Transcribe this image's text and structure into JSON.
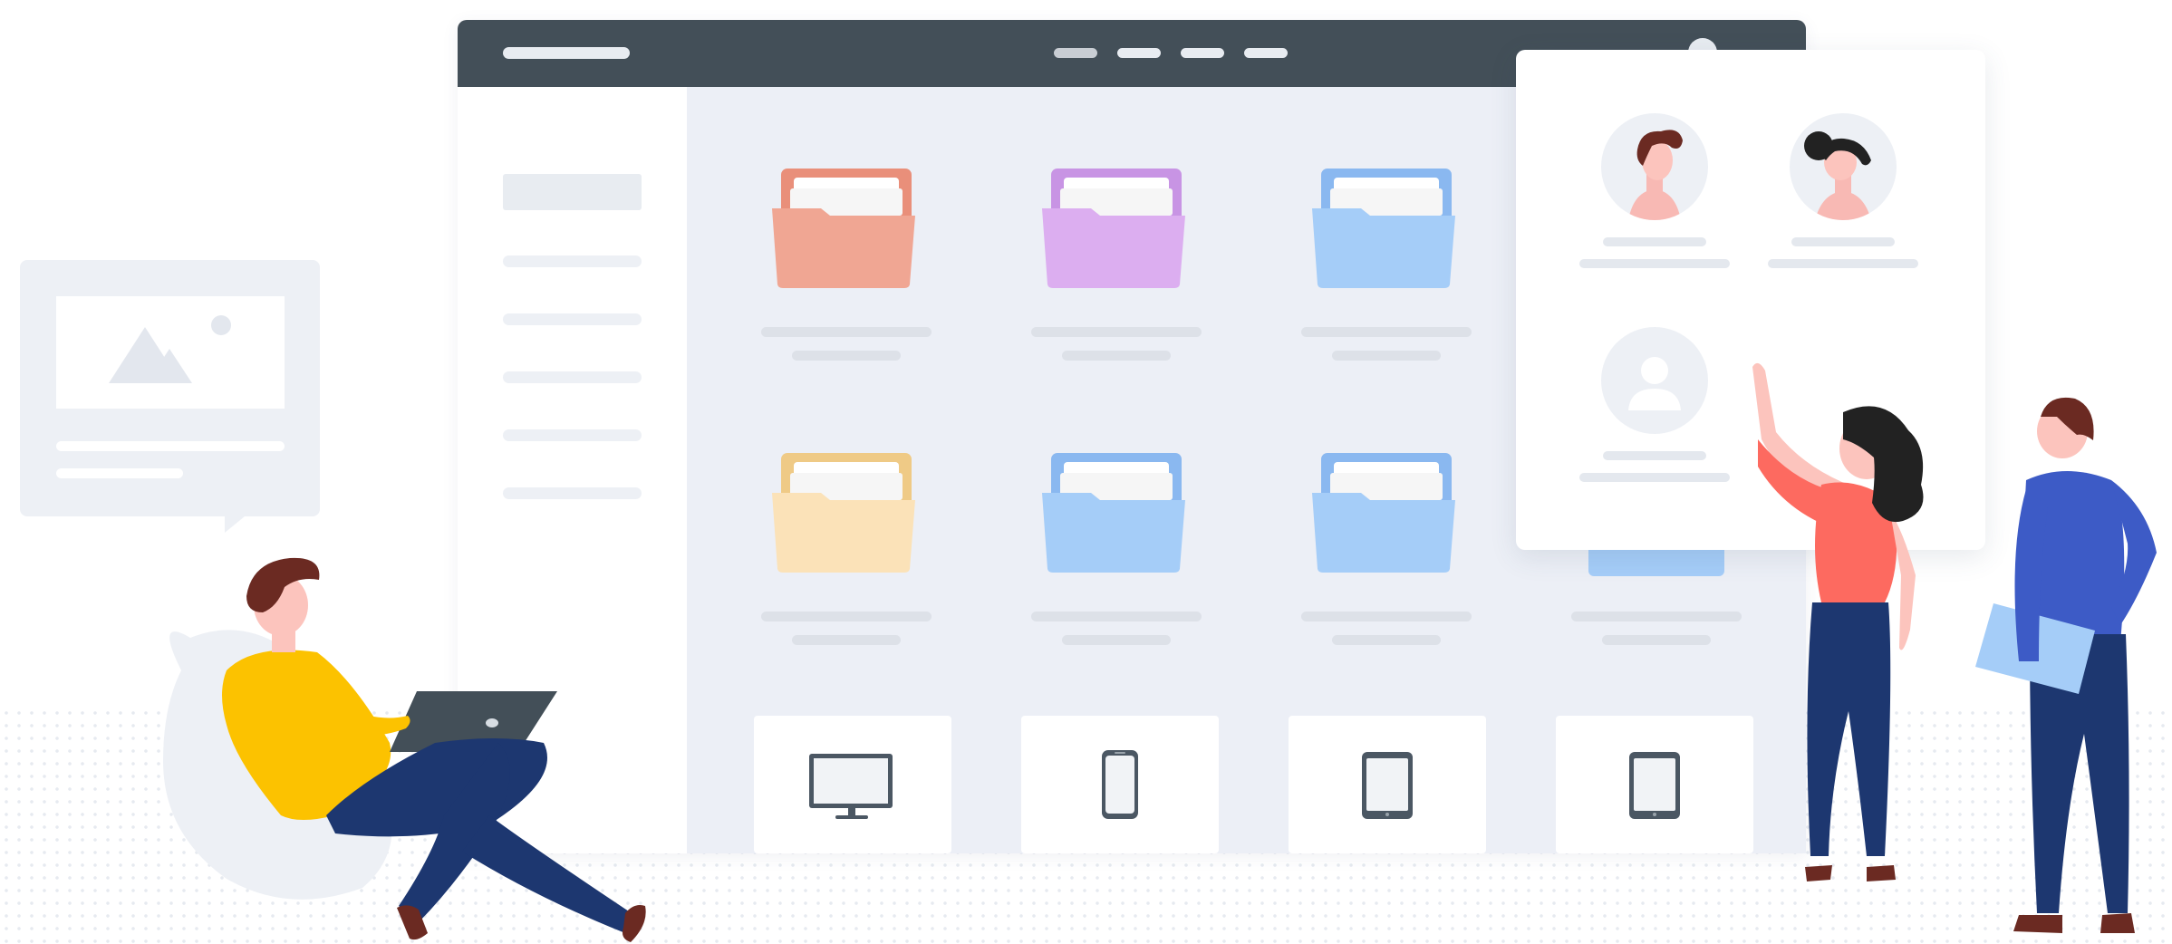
{
  "colors": {
    "titlebar": "#434f58",
    "main_bg": "#eceff6",
    "placeholder": "#e8ecf1",
    "folder_salmon": "#f0a693",
    "folder_purple": "#dcaef0",
    "folder_blue": "#a5cdf8",
    "folder_peach": "#fbe2b8",
    "person_yellow": "#fcc200",
    "person_navy": "#1d3770",
    "person_coral": "#fd6a60",
    "person_blue": "#3d5bc6"
  },
  "window": {
    "nav_items": [
      "nav-item-1",
      "nav-item-2",
      "nav-item-3",
      "nav-item-4"
    ],
    "sidebar_items": 6
  },
  "folders": [
    {
      "color": "salmon"
    },
    {
      "color": "purple"
    },
    {
      "color": "blue"
    },
    {
      "color": "peach"
    },
    {
      "color": "blue"
    },
    {
      "color": "blue"
    },
    {
      "color": "blue"
    }
  ],
  "devices": [
    "monitor-icon",
    "phone-icon",
    "tablet-icon",
    "tablet-icon"
  ],
  "users_panel": {
    "users": [
      "user-man",
      "user-woman",
      "user-placeholder"
    ]
  }
}
